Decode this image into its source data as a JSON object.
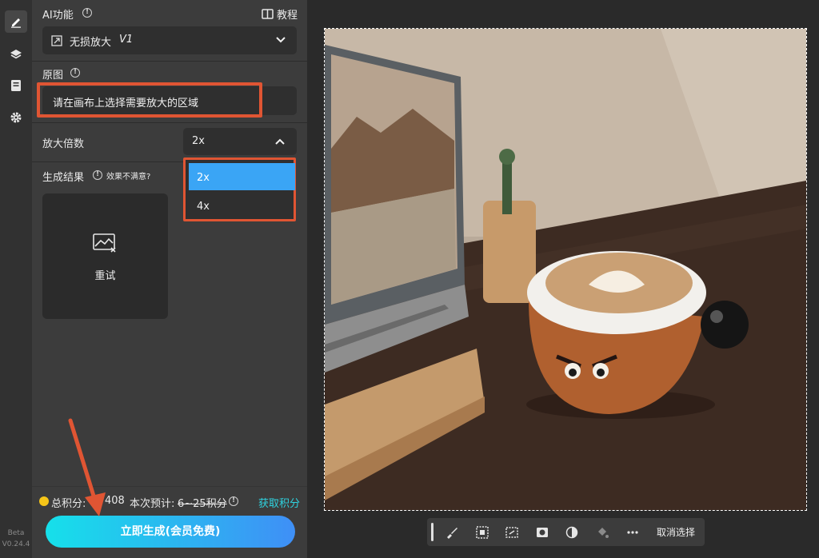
{
  "rail": {
    "items": [
      "edit-icon",
      "layers-icon",
      "notes-icon",
      "settings-icon"
    ],
    "beta_label": "Beta",
    "version": "V0.24.4"
  },
  "panel": {
    "ai_function_label": "AI功能",
    "tutorial_label": "教程",
    "ai_select_value": "无损放大",
    "ai_select_suffix": "V1",
    "original_label": "原图",
    "original_hint": "请在画布上选择需要放大的区域",
    "scale_label": "放大倍数",
    "scale_value": "2x",
    "scale_options": [
      "2x",
      "4x"
    ],
    "result_label": "生成结果",
    "result_unsatisfied": "效果不满意?",
    "retry_label": "重试"
  },
  "footer": {
    "points_label": "总积分:",
    "points_value": "408",
    "estimate_label": "本次预计:",
    "estimate_value": "6~25积分",
    "get_points": "获取积分",
    "generate_button": "立即生成(会员免费)"
  },
  "toolbar": {
    "icons": [
      "brush-icon",
      "select-region-icon",
      "crop-select-icon",
      "mask-icon",
      "invert-icon",
      "fill-icon",
      "more-icon"
    ],
    "deselect_label": "取消选择"
  },
  "colors": {
    "accent_red": "#e05533",
    "highlight_blue": "#3aa5f5",
    "gradient_start": "#16e0ea",
    "gradient_end": "#3f8ff6",
    "link_cyan": "#2fd3e0"
  }
}
